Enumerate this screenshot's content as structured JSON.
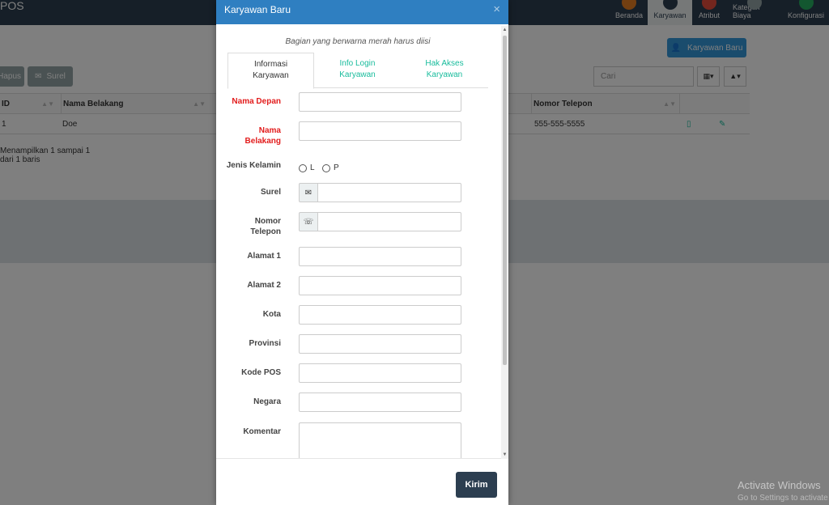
{
  "app": {
    "brand": "POS",
    "nav": [
      {
        "label": "Beranda",
        "icon": "home-icon",
        "color": "#e67e22"
      },
      {
        "label": "Karyawan",
        "icon": "employee-icon",
        "color": "#2c3e50"
      },
      {
        "label": "Atribut",
        "icon": "attribute-icon",
        "color": "#e74c3c"
      },
      {
        "label": "Kategori Biaya",
        "icon": "expense-category-icon",
        "color": "#95a5a6"
      },
      {
        "label": "Konfigurasi",
        "icon": "config-icon",
        "color": "#27ae60"
      }
    ],
    "new_button": "Karyawan Baru",
    "delete_button": "Hapus",
    "email_button": "Surel",
    "search_placeholder": "Cari",
    "table": {
      "headers": [
        "ID",
        "Nama Belakang",
        "Nomor Telepon"
      ],
      "row": {
        "id": "1",
        "last_name": "Doe",
        "phone": "555-555-5555"
      }
    },
    "footer_text": "Menampilkan 1 sampai 1 dari 1 baris"
  },
  "modal": {
    "title": "Karyawan Baru",
    "close": "×",
    "required_note": "Bagian yang berwarna merah harus diisi",
    "tabs": [
      {
        "line1": "Informasi",
        "line2": "Karyawan"
      },
      {
        "line1": "Info Login",
        "line2": "Karyawan"
      },
      {
        "line1": "Hak Akses",
        "line2": "Karyawan"
      }
    ],
    "fields": {
      "first_name": "Nama Depan",
      "last_name_1": "Nama",
      "last_name_2": "Belakang",
      "gender": "Jenis Kelamin",
      "gender_l": "L",
      "gender_p": "P",
      "email": "Surel",
      "phone_1": "Nomor",
      "phone_2": "Telepon",
      "address1": "Alamat 1",
      "address2": "Alamat 2",
      "city": "Kota",
      "state": "Provinsi",
      "zip": "Kode POS",
      "country": "Negara",
      "comments": "Komentar"
    },
    "submit": "Kirim"
  },
  "os": {
    "watermark_line1": "Activate Windows",
    "watermark_line2": "Go to Settings to activate Windows."
  }
}
